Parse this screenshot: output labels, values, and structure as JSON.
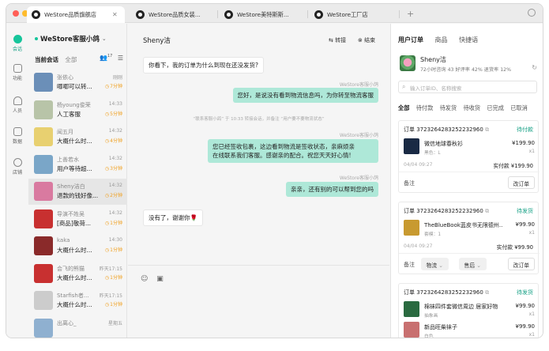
{
  "tabs": [
    {
      "label": "WeStore品质旗舰店"
    },
    {
      "label": "WeStore品质女装..."
    },
    {
      "label": "WeStore美特斯斯..."
    },
    {
      "label": "WeStore工厂店"
    }
  ],
  "nav": [
    {
      "label": "会话"
    },
    {
      "label": "功能"
    },
    {
      "label": "人员"
    },
    {
      "label": "数据"
    },
    {
      "label": "店铺"
    }
  ],
  "account": {
    "name": "WeStore客服小鸽"
  },
  "conv_tabs": {
    "current": "当前会话",
    "all": "全部",
    "badge": "17"
  },
  "conversations": [
    {
      "name": "张依心",
      "msg": "唧唧可以转...",
      "time": "刚刚",
      "wait": "7分钟",
      "color": "#6b8fb8"
    },
    {
      "name": "杨young俊荣",
      "msg": "人工客服",
      "time": "14:33",
      "wait": "5分钟",
      "color": "#b8c4a8"
    },
    {
      "name": "闻五月",
      "msg": "大概什么时...",
      "time": "14:32",
      "wait": "4分钟",
      "color": "#e8d070"
    },
    {
      "name": "上善若水",
      "msg": "用户等待超...",
      "time": "14:32",
      "wait": "3分钟",
      "color": "#7aa6c8"
    },
    {
      "name": "Sheny洁白",
      "msg": "退款的钱好像...",
      "time": "14:32",
      "wait": "2分钟",
      "color": "#d97aa0"
    },
    {
      "name": "导演不姓吴",
      "msg": "[商品]敬荷...",
      "time": "14:32",
      "wait": "1分钟",
      "color": "#c83030"
    },
    {
      "name": "kaka",
      "msg": "大概什么时...",
      "time": "14:30",
      "wait": "1分钟",
      "color": "#8a2a2a"
    },
    {
      "name": "会飞的熊猫",
      "msg": "大概什么时...",
      "time": "昨天17:15",
      "wait": "1分钟",
      "color": "#c83030"
    },
    {
      "name": "Starfish者...",
      "msg": "大概什么时...",
      "time": "昨天17:15",
      "wait": "1分钟",
      "color": "#cccccc"
    },
    {
      "name": "出离心_",
      "msg": "",
      "time": "星期五",
      "wait": "",
      "color": "#8fb0d0"
    }
  ],
  "chat": {
    "title": "Sheny洁",
    "transfer": "转接",
    "end": "结束",
    "messages": [
      {
        "dir": "in",
        "text": "你看下，我的订单为什么到现在还没发货?"
      },
      {
        "dir": "out",
        "sender": "WeStore客服小鸽",
        "text": "您好，是说没有看到物流信息吗，为你转至物流客服"
      },
      {
        "dir": "sys",
        "text": "“联系客服小鸽” 于 10:33 转接会话，并备注 “用户要不要物流状态”"
      },
      {
        "dir": "out",
        "sender": "WeStore客服小鸽",
        "text1": "您已经签收包裹，这边看到物流是签收状态，亲麻烦亲",
        "text2": "在线联系我们客服。感谢亲的配合。祝您天天好心情!"
      },
      {
        "dir": "out",
        "sender": "WeStore客服小鸽",
        "text": "亲亲，还有别的可以帮到您的吗"
      },
      {
        "dir": "in",
        "text": "没有了，谢谢你🌹"
      }
    ]
  },
  "right": {
    "tabs": [
      "用户订单",
      "商品",
      "快捷语"
    ],
    "customer": {
      "name": "Sheny洁",
      "stats": "72小时咨询 43  好评率 42%  退货率 12%"
    },
    "search_placeholder": "输入订单ID、名称搜索",
    "order_tabs": [
      "全部",
      "待付款",
      "待发货",
      "待收货",
      "已完成",
      "已取消"
    ],
    "orders": [
      {
        "no": "订单 3723264283252232960",
        "status": "待付款",
        "items": [
          {
            "name": "微信地球春秋衫",
            "sku": "黑色：L",
            "price": "¥199.90",
            "qty": "x1",
            "color": "#1a2a44"
          }
        ],
        "date": "04/04 09:27",
        "pay": "实付款 ¥199.90",
        "note": "备注",
        "buttons": [
          "改订单"
        ]
      },
      {
        "no": "订单 3723264283252232960",
        "status": "待发货",
        "items": [
          {
            "name": "TheBlueBook蓝皮书无限德州...",
            "sku": "套模：1",
            "price": "¥99.90",
            "qty": "x1",
            "color": "#c89a30"
          }
        ],
        "date": "04/04 09:27",
        "pay": "实付款 ¥99.90",
        "note": "备注",
        "buttons": [
          "物流",
          "售后",
          "改订单"
        ]
      },
      {
        "no": "订单 3723264283252232960",
        "status": "待发货",
        "items": [
          {
            "name": "棉袜四件套微信周边 居家好物",
            "sku": "抽象画",
            "price": "¥99.90",
            "qty": "x1",
            "color": "#2a6a40"
          },
          {
            "name": "新品旺柴袜子",
            "sku": "白色",
            "price": "¥99.90",
            "qty": "x1",
            "color": "#c87070"
          }
        ]
      }
    ]
  }
}
